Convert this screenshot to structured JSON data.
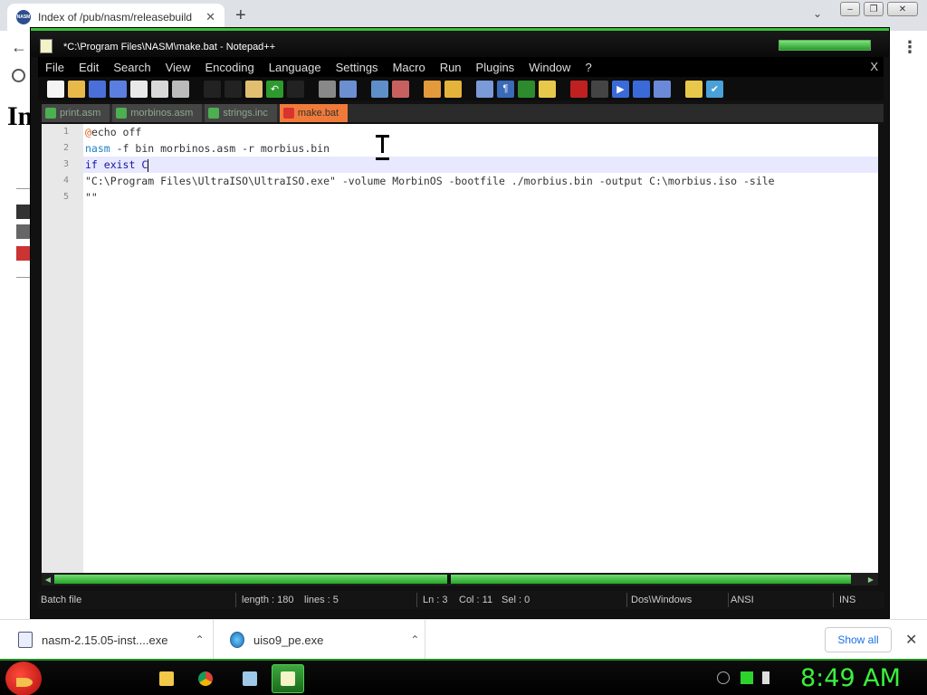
{
  "browser": {
    "tab_title": "Index of /pub/nasm/releasebuild",
    "tab_favicon_text": "NASM",
    "new_tab_symbol": "+",
    "tab_close_symbol": "✕",
    "page_heading_partial": "In"
  },
  "notepad": {
    "title": "*C:\\Program Files\\NASM\\make.bat - Notepad++",
    "menu": [
      "File",
      "Edit",
      "Search",
      "View",
      "Encoding",
      "Language",
      "Settings",
      "Macro",
      "Run",
      "Plugins",
      "Window",
      "?"
    ],
    "menu_close": "X",
    "tabs": [
      {
        "label": "print.asm",
        "active": false
      },
      {
        "label": "morbinos.asm",
        "active": false
      },
      {
        "label": "strings.inc",
        "active": false
      },
      {
        "label": "make.bat",
        "active": true
      }
    ],
    "line_numbers": [
      "1",
      "2",
      "3",
      "4",
      "5"
    ],
    "code": {
      "line1_at": "@",
      "line1_rest": "echo off",
      "line2_cmd": "nasm",
      "line2_rest": " -f bin morbinos.asm -r morbius.bin",
      "line3_kw": "if exist ",
      "line3_rest": "C",
      "line4": "\"C:\\Program Files\\UltraISO\\UltraISO.exe\" -volume MorbinOS -bootfile ./morbius.bin -output C:\\morbius.iso -sile",
      "line5": "\"\""
    },
    "status": {
      "filetype": "Batch file",
      "length": "length : 180",
      "lines": "lines : 5",
      "ln": "Ln : 3",
      "col": "Col : 11",
      "sel": "Sel : 0",
      "eol": "Dos\\Windows",
      "encoding": "ANSI",
      "mode": "INS"
    }
  },
  "downloads": {
    "items": [
      "nasm-2.15.05-inst....exe",
      "uiso9_pe.exe"
    ],
    "show_all": "Show all"
  },
  "taskbar": {
    "clock": "8:49 AM"
  },
  "colors": {
    "accent_green": "#3bf03b",
    "active_tab": "#f07a3a",
    "link_blue": "#1a73e8"
  }
}
